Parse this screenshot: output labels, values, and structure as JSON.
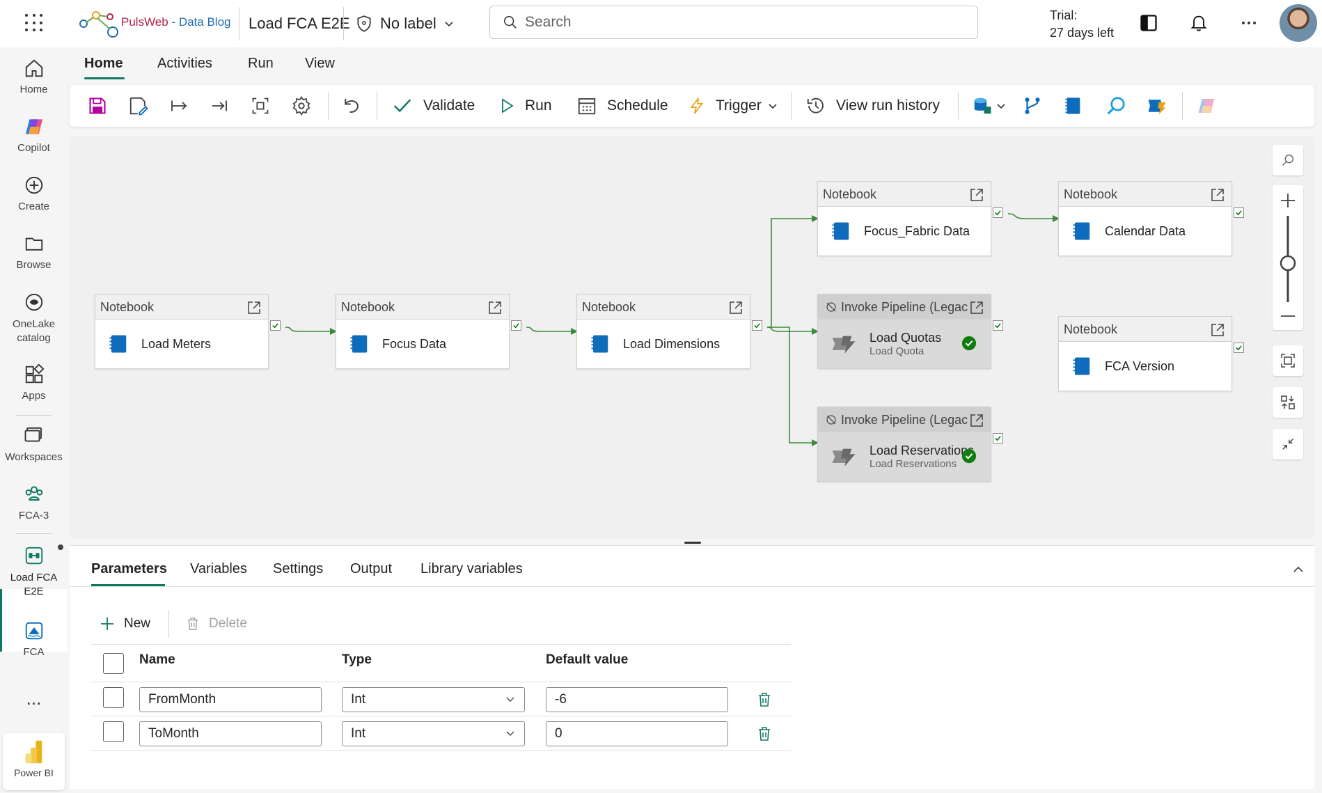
{
  "app": {
    "brand": "PulsWeb - Data Blog",
    "brand_part1": "PulsWeb",
    "brand_part2": " - Data Blog",
    "pipeline_title": "Load FCA E2E",
    "sensitivity_label": "No label",
    "search_placeholder": "Search",
    "trial_line1": "Trial:",
    "trial_line2": "27 days left"
  },
  "rail": {
    "items": [
      {
        "label": "Home",
        "icon": "home-icon"
      },
      {
        "label": "Copilot",
        "icon": "copilot-icon"
      },
      {
        "label": "Create",
        "icon": "plus-circle-icon"
      },
      {
        "label": "Browse",
        "icon": "folder-icon"
      },
      {
        "label": "OneLake catalog",
        "icon": "onelake-icon"
      },
      {
        "label": "Apps",
        "icon": "apps-icon"
      },
      {
        "label": "Workspaces",
        "icon": "workspaces-icon"
      },
      {
        "label": "FCA-3",
        "icon": "people-icon"
      },
      {
        "label": "Load FCA E2E",
        "icon": "pipeline-icon"
      },
      {
        "label": "FCA",
        "icon": "lakehouse-icon"
      },
      {
        "label": "...",
        "icon": "more-icon"
      }
    ],
    "powerbi_label": "Power BI"
  },
  "tabs": [
    "Home",
    "Activities",
    "Run",
    "View"
  ],
  "toolbar": {
    "validate": "Validate",
    "run": "Run",
    "schedule": "Schedule",
    "trigger": "Trigger",
    "view_run_history": "View run history"
  },
  "nodes": [
    {
      "type": "Notebook",
      "name": "Load Meters"
    },
    {
      "type": "Notebook",
      "name": "Focus Data"
    },
    {
      "type": "Notebook",
      "name": "Load Dimensions"
    },
    {
      "type": "Notebook",
      "name": "Focus_Fabric Data"
    },
    {
      "type": "Notebook",
      "name": "Calendar Data"
    },
    {
      "type": "Invoke Pipeline (Legac",
      "name": "Load Quotas",
      "sub": "Load Quota"
    },
    {
      "type": "Notebook",
      "name": "FCA Version"
    },
    {
      "type": "Invoke Pipeline (Legac",
      "name": "Load Reservations",
      "sub": "Load Reservations"
    }
  ],
  "panel": {
    "tabs": [
      "Parameters",
      "Variables",
      "Settings",
      "Output",
      "Library variables"
    ],
    "new_label": "New",
    "delete_label": "Delete",
    "columns": [
      "Name",
      "Type",
      "Default value"
    ],
    "rows": [
      {
        "name": "FromMonth",
        "type": "Int",
        "default": "-6"
      },
      {
        "name": "ToMonth",
        "type": "Int",
        "default": "0"
      }
    ]
  },
  "colors": {
    "accent": "#117865",
    "notebook_blue": "#0f6cbd",
    "success": "#107c10",
    "connector": "#3a8a3a"
  }
}
